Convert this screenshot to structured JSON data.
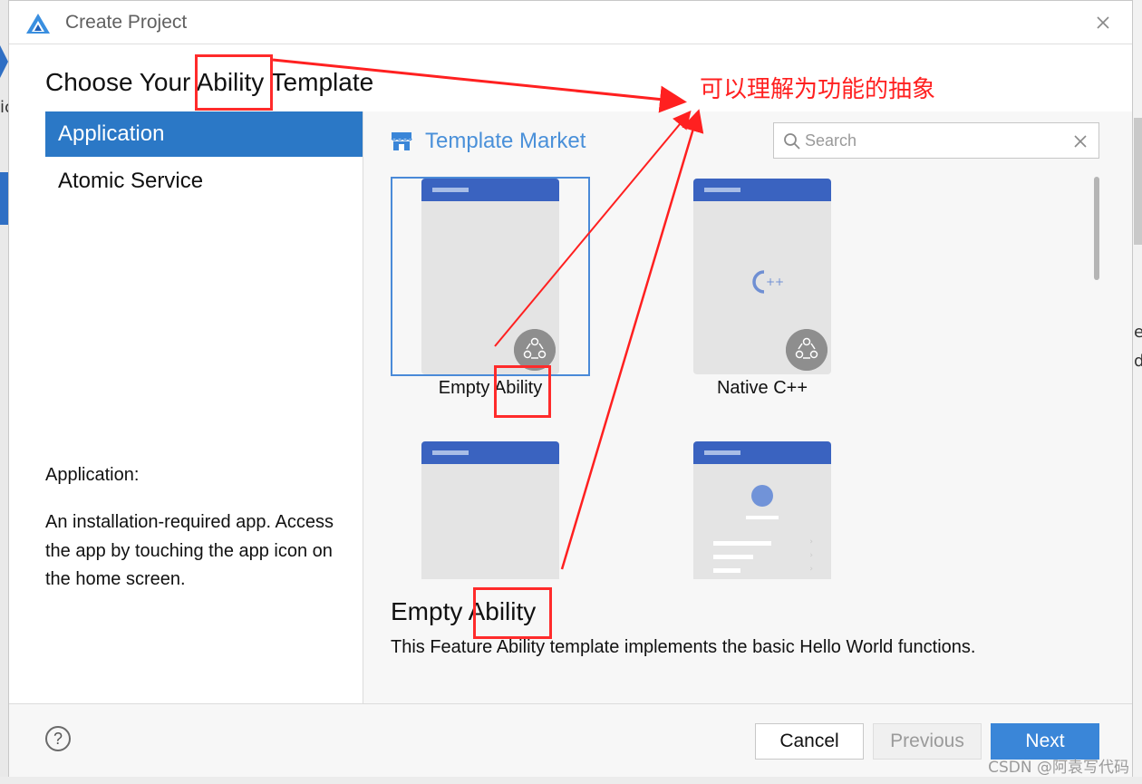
{
  "dialog": {
    "title": "Create Project",
    "heading": "Choose Your Ability Template"
  },
  "sidebar": {
    "items": [
      {
        "label": "Application",
        "active": true
      },
      {
        "label": "Atomic Service",
        "active": false
      }
    ],
    "description_title": "Application:",
    "description_body": "An installation-required app. Access the app by touching the app icon on the home screen."
  },
  "templates": {
    "market_label": "Template Market",
    "search_placeholder": "Search",
    "cards": [
      {
        "label": "Empty Ability",
        "selected": true,
        "icon": "ability-badge-icon"
      },
      {
        "label": "Native C++",
        "selected": false,
        "icon": "cpp-icon"
      },
      {
        "label": "",
        "selected": false,
        "icon": "blank-page"
      },
      {
        "label": "",
        "selected": false,
        "icon": "profile-list-page"
      }
    ],
    "detail_title": "Empty Ability",
    "detail_description": "This Feature Ability template implements the basic Hello World functions."
  },
  "footer": {
    "help_label": "?",
    "cancel_label": "Cancel",
    "previous_label": "Previous",
    "next_label": "Next"
  },
  "annotation": {
    "note": "可以理解为功能的抽象",
    "color": "#ff2020"
  },
  "watermark": "CSDN @阿袁写代码",
  "colors": {
    "accent": "#2b78c6",
    "market": "#4a90d9",
    "phone_header": "#3a63c0",
    "next_button": "#3a86d8"
  }
}
